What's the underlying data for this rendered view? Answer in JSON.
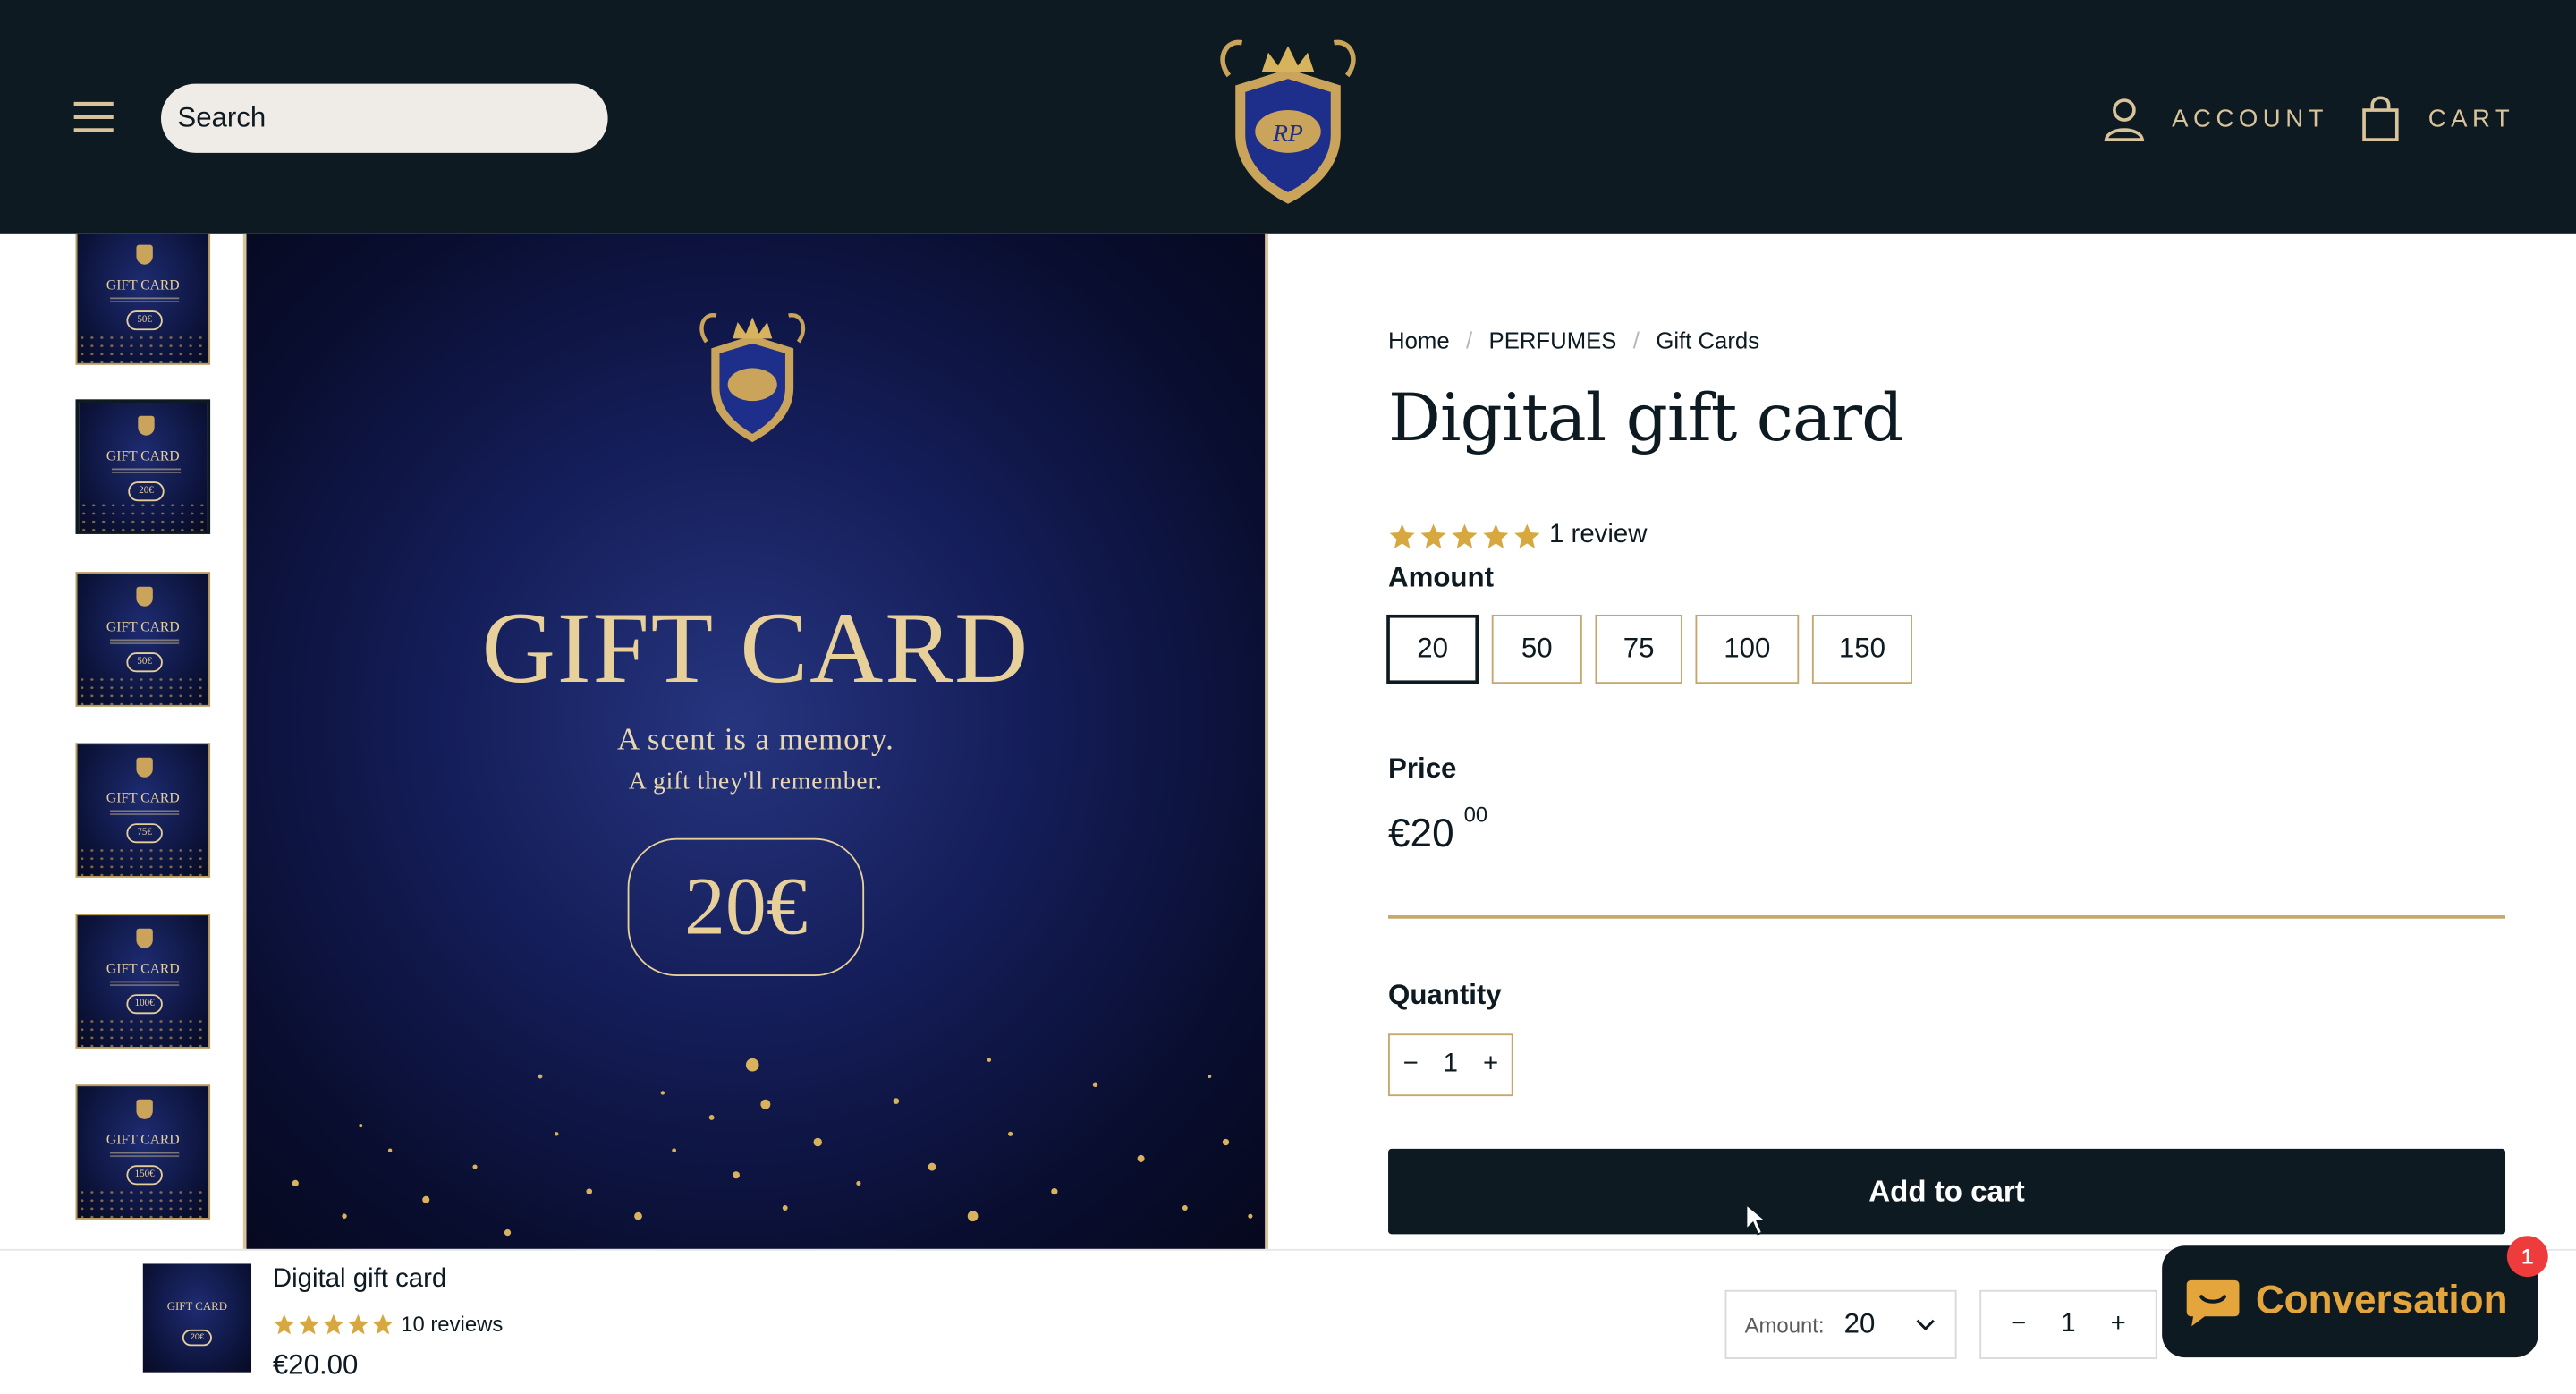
{
  "header": {
    "search_placeholder": "Search",
    "logo_initials": "RP",
    "account_label": "ACCOUNT",
    "cart_label": "CART"
  },
  "thumbnails": [
    {
      "title": "GIFT CARD",
      "amount": "50€"
    },
    {
      "title": "GIFT CARD",
      "amount": "20€"
    },
    {
      "title": "GIFT CARD",
      "amount": "50€"
    },
    {
      "title": "GIFT CARD",
      "amount": "75€"
    },
    {
      "title": "GIFT CARD",
      "amount": "100€"
    },
    {
      "title": "GIFT CARD",
      "amount": "150€"
    }
  ],
  "main_image": {
    "title": "GIFT CARD",
    "line1": "A scent is a memory.",
    "line2": "A gift they'll remember.",
    "amount": "20€"
  },
  "breadcrumb": {
    "home": "Home",
    "category": "PERFUMES",
    "current": "Gift Cards"
  },
  "product": {
    "title": "Digital gift card",
    "rating": 5,
    "review_text": "1 review",
    "amount_label": "Amount",
    "amounts": [
      "20",
      "50",
      "75",
      "100",
      "150"
    ],
    "selected_amount": "20",
    "price_label": "Price",
    "price_main": "€20",
    "price_cents": "00",
    "quantity_label": "Quantity",
    "quantity": "1",
    "add_to_cart": "Add to cart"
  },
  "sticky_bar": {
    "name": "Digital gift card",
    "rating": 5,
    "reviews": "10 reviews",
    "price": "€20.00",
    "amount_label": "Amount:",
    "amount_value": "20",
    "quantity": "1",
    "thumb_title": "GIFT CARD",
    "thumb_amount": "20€"
  },
  "chat": {
    "label": "Conversation",
    "badge": "1"
  },
  "colors": {
    "header_bg": "#0e1a22",
    "gold": "#c6a66a",
    "star": "#d7a840",
    "chat_accent": "#e4a53c"
  }
}
